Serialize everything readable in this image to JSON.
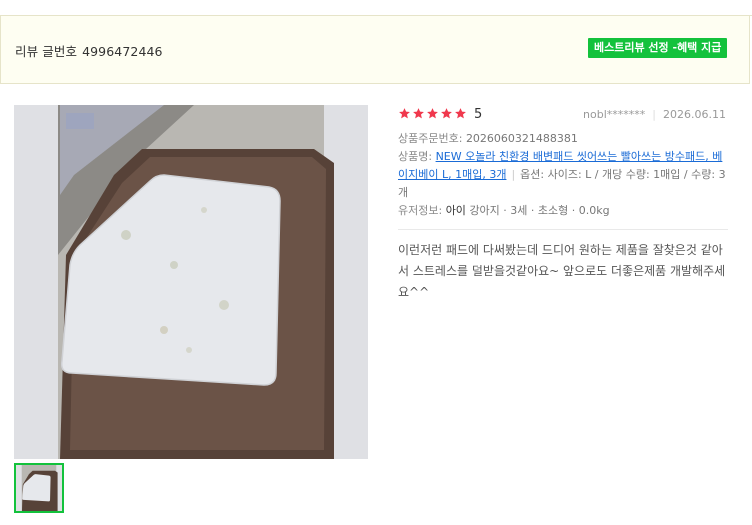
{
  "header": {
    "review_label": "리뷰 글번호",
    "review_number": "4996472446",
    "badge": "베스트리뷰 선정 -혜택 지급"
  },
  "review": {
    "rating": 5,
    "rating_display": "5",
    "author": "nobl*******",
    "date": "2026.06.11",
    "order_label": "상품주문번호:",
    "order_number": "2026060321488381",
    "product_label": "상품명:",
    "product_name": "NEW 오놀라 친환경 배변패드 씻어쓰는 빨아쓰는 방수패드, 베이지베이 L, 1매입, 3개",
    "option_text": "옵션: 사이즈: L / 개당 수량: 1매입 / 수량: 3개",
    "pet_label": "유저정보:",
    "pet_name": "아이",
    "pet_detail": "강아지 · 3세 · 초소형 · 0.0kg",
    "body": "이런저런 패드에 다써봤는데 드디어 원하는 제품을 잘찾은것 같아서 스트레스를 덜받을것같아요~ 앞으로도 더좋은제품 개발해주세요^^"
  },
  "colors": {
    "accent_green": "#13c23c",
    "star_red": "#f0384d",
    "link_blue": "#1a6bd6",
    "header_bg": "#fefef2"
  },
  "icons": [
    "star-icon"
  ]
}
